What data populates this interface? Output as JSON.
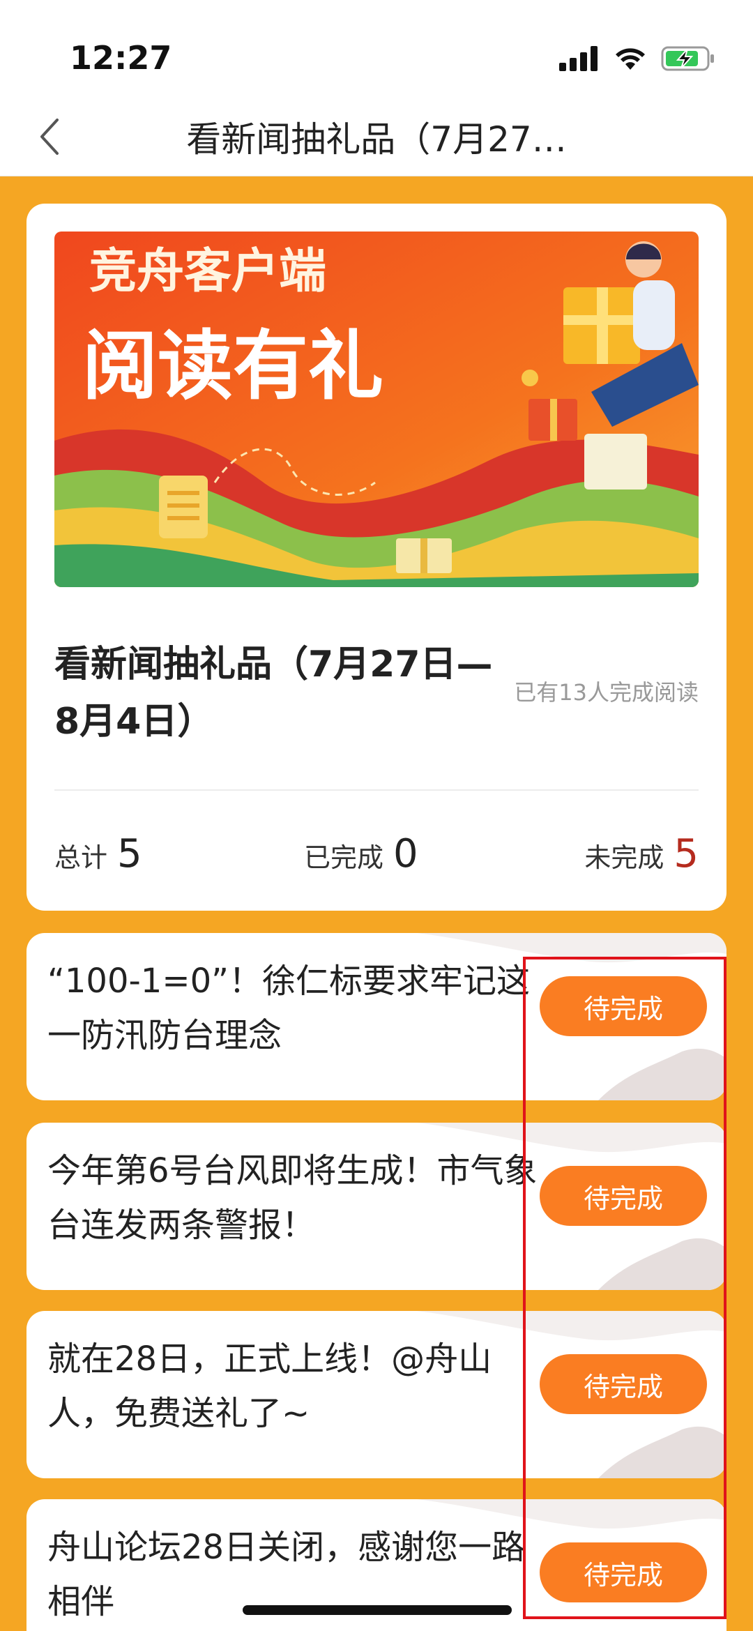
{
  "status_bar": {
    "time": "12:27"
  },
  "nav": {
    "title": "看新闻抽礼品（7月27…"
  },
  "banner": {
    "line1": "竞舟客户端",
    "line2": "阅读有礼"
  },
  "activity": {
    "title": "看新闻抽礼品（7月27日—8月4日）",
    "readers": "已有13人完成阅读"
  },
  "stats": {
    "total_label": "总计",
    "total_value": "5",
    "done_label": "已完成",
    "done_value": "0",
    "todo_label": "未完成",
    "todo_value": "5"
  },
  "articles": [
    {
      "title": "“100-1=0”！徐仁标要求牢记这一防汛防台理念",
      "status": "待完成"
    },
    {
      "title": "今年第6号台风即将生成！市气象台连发两条警报！",
      "status": "待完成"
    },
    {
      "title": "就在28日，正式上线！@舟山人，免费送礼了~",
      "status": "待完成"
    },
    {
      "title": "舟山论坛28日关闭，感谢您一路相伴",
      "status": "待完成"
    }
  ],
  "colors": {
    "page_bg": "#F5A623",
    "button": "#FA7D22",
    "todo_num": "#B52B1E",
    "highlight": "#E0131A"
  }
}
